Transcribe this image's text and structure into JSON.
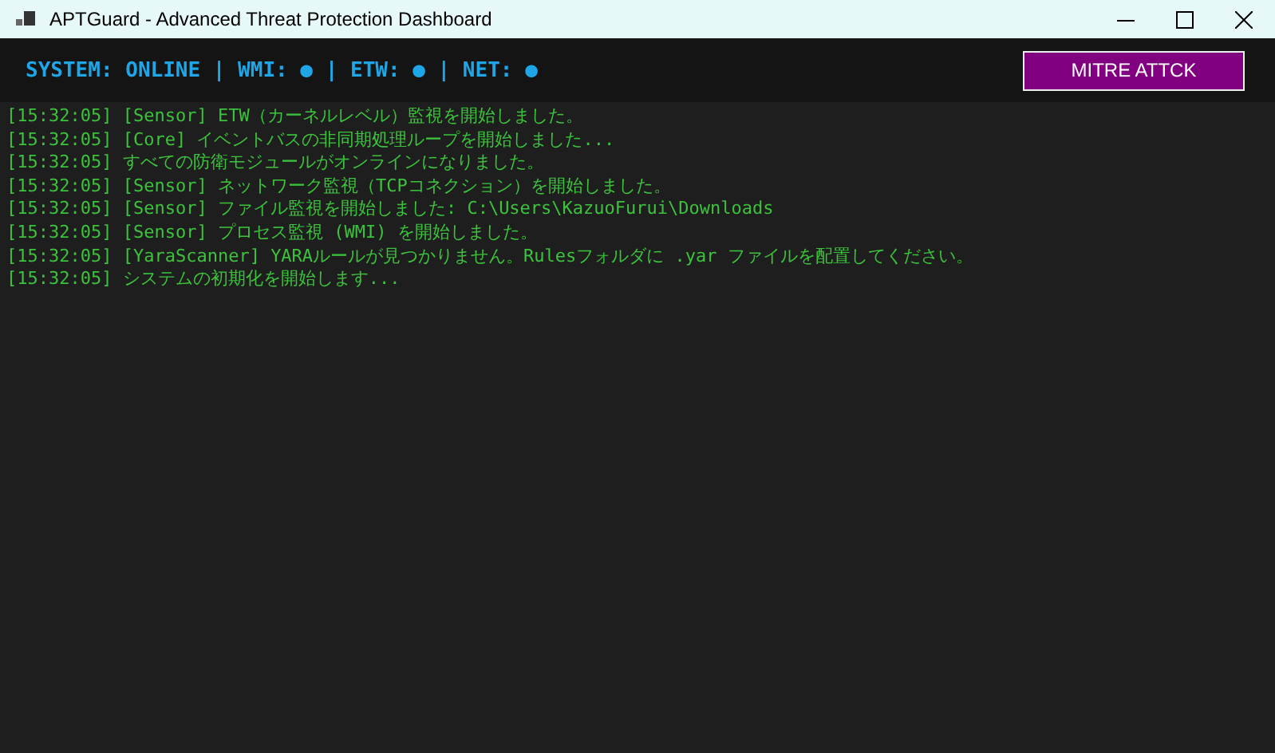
{
  "window": {
    "title": "APTGuard - Advanced Threat Protection Dashboard"
  },
  "status_bar": {
    "text": "SYSTEM: ONLINE | WMI: ● | ETW: ● | NET: ●"
  },
  "mitre_button": {
    "label": "MITRE ATTCK"
  },
  "log": [
    "[15:32:05] [Sensor] ETW（カーネルレベル）監視を開始しました。",
    "[15:32:05] [Core] イベントバスの非同期処理ループを開始しました...",
    "[15:32:05] すべての防衛モジュールがオンラインになりました。",
    "[15:32:05] [Sensor] ネットワーク監視（TCPコネクション）を開始しました。",
    "[15:32:05] [Sensor] ファイル監視を開始しました: C:\\Users\\KazuoFurui\\Downloads",
    "[15:32:05] [Sensor] プロセス監視 (WMI) を開始しました。",
    "[15:32:05] [YaraScanner] YARAルールが見つかりません。Rulesフォルダに .yar ファイルを配置してください。",
    "[15:32:05] システムの初期化を開始します..."
  ]
}
